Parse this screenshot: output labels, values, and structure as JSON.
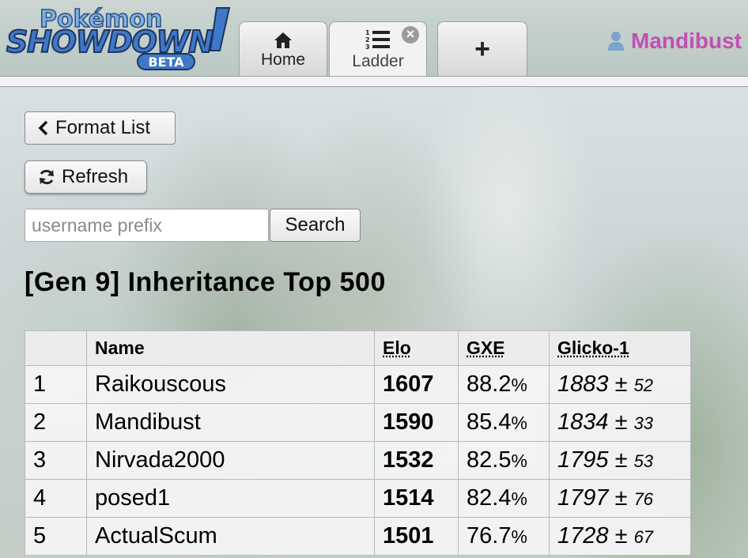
{
  "header": {
    "logo": {
      "line1": "Pokémon",
      "line2": "SHOWDOWN",
      "badge": "BETA"
    },
    "tabs": [
      {
        "label": "Home",
        "icon": "home-icon"
      },
      {
        "label": "Ladder",
        "icon": "ordered-list-icon",
        "active": true,
        "close": "×"
      },
      {
        "label": "+",
        "icon": "plus-icon"
      }
    ],
    "user": {
      "name": "Mandibust",
      "icon": "user-icon",
      "color": "#c24fb2"
    }
  },
  "controls": {
    "format_list_label": "Format List",
    "refresh_label": "Refresh",
    "search_placeholder": "username prefix",
    "search_value": "",
    "search_button_label": "Search"
  },
  "ladder": {
    "title": "[Gen 9] Inheritance Top 500",
    "columns": {
      "rank": "",
      "name": "Name",
      "elo": "Elo",
      "gxe": "GXE",
      "glicko": "Glicko-1"
    },
    "rows": [
      {
        "rank": "1",
        "name": "Raikouscous",
        "elo": "1607",
        "gxe": "88.2",
        "glicko": "1883",
        "dev": "52"
      },
      {
        "rank": "2",
        "name": "Mandibust",
        "elo": "1590",
        "gxe": "85.4",
        "glicko": "1834",
        "dev": "33"
      },
      {
        "rank": "3",
        "name": "Nirvada2000",
        "elo": "1532",
        "gxe": "82.5",
        "glicko": "1795",
        "dev": "53"
      },
      {
        "rank": "4",
        "name": "posed1",
        "elo": "1514",
        "gxe": "82.4",
        "glicko": "1797",
        "dev": "76"
      },
      {
        "rank": "5",
        "name": "ActualScum",
        "elo": "1501",
        "gxe": "76.7",
        "glicko": "1728",
        "dev": "67"
      }
    ]
  }
}
